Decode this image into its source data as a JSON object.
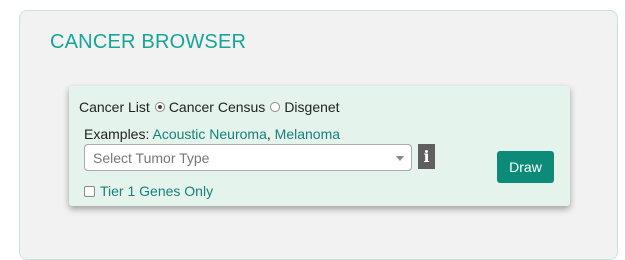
{
  "panel": {
    "title": "CANCER BROWSER"
  },
  "source_selector": {
    "options": [
      {
        "label": "Cancer List",
        "checked": true
      },
      {
        "label": "Cancer Census",
        "checked": false
      },
      {
        "label": "Disgenet",
        "checked": false
      }
    ]
  },
  "examples": {
    "prefix": "Examples:",
    "links": [
      "Acoustic Neuroma",
      "Melanoma"
    ],
    "separator": ","
  },
  "tumor_select": {
    "placeholder": "Select Tumor Type"
  },
  "info": {
    "glyph": "i"
  },
  "tier_filter": {
    "label": "Tier 1 Genes Only",
    "checked": false
  },
  "actions": {
    "draw_label": "Draw"
  },
  "colors": {
    "accent": "#17a597",
    "link": "#17817a",
    "button": "#0c8b79",
    "card_background": "#e4f3ec"
  },
  "icons": {
    "info": "info-icon",
    "dropdown": "chevron-down-icon"
  }
}
